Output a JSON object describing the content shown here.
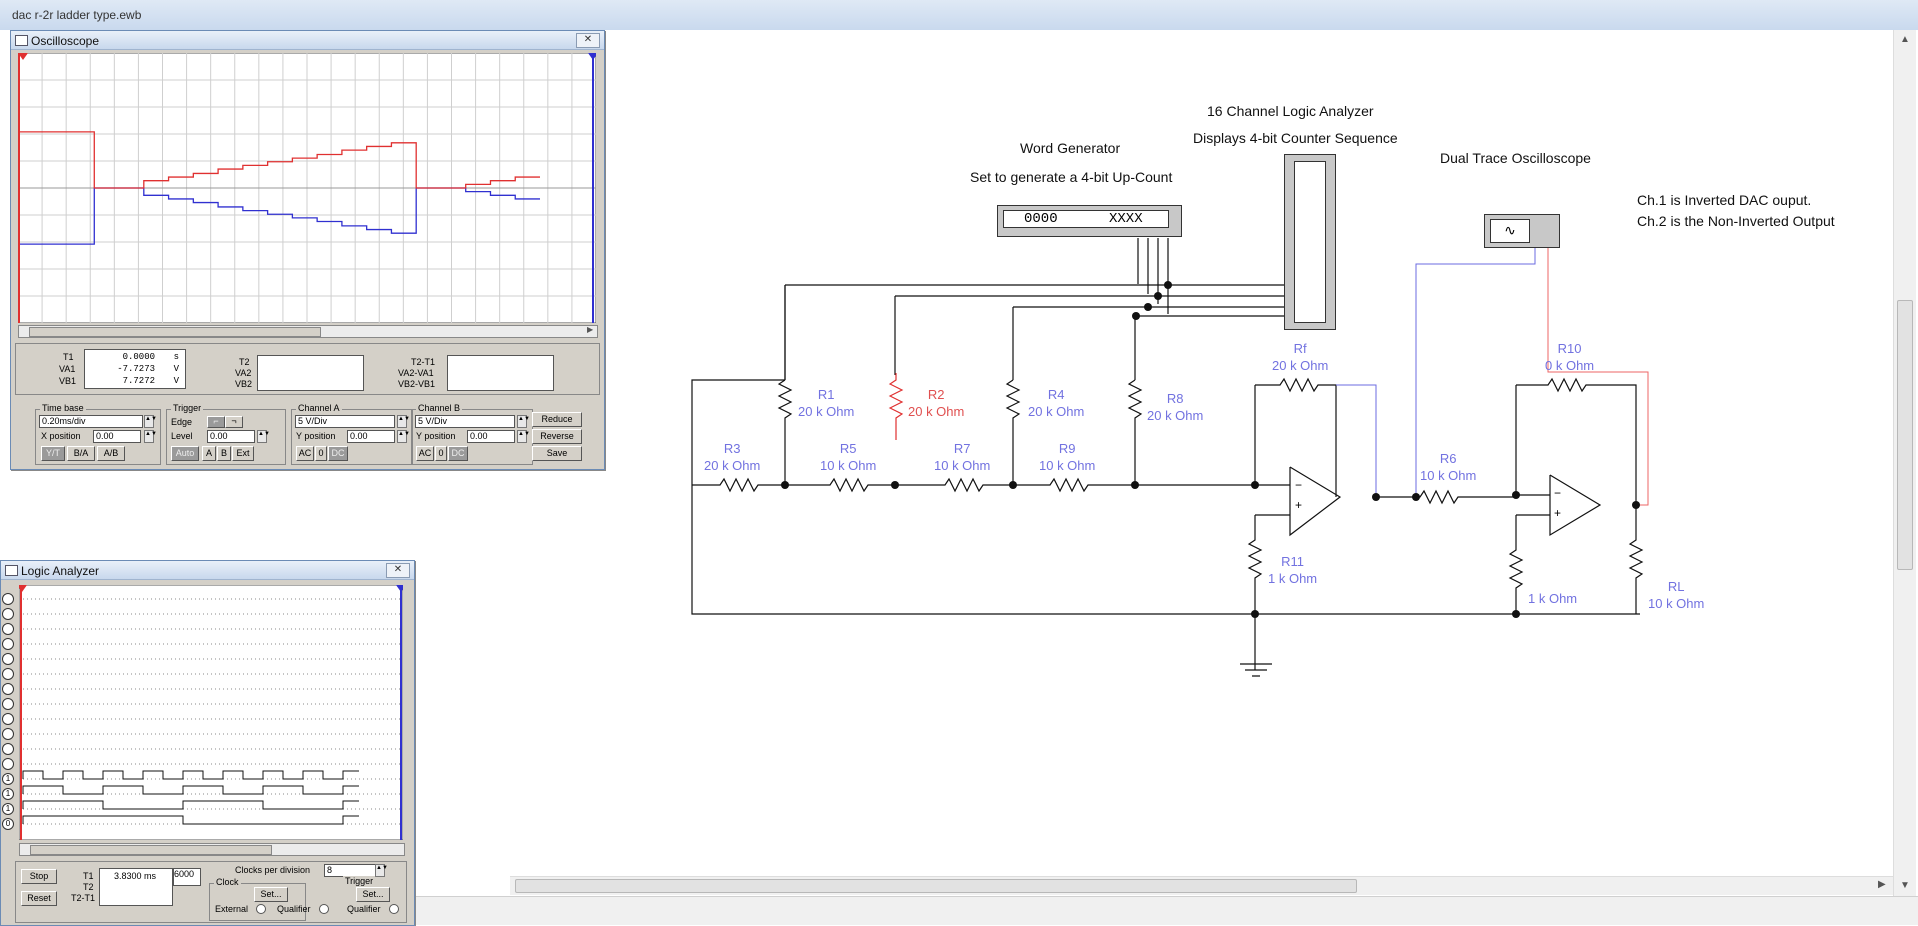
{
  "app": {
    "title": "dac r-2r ladder type.ewb"
  },
  "colors": {
    "channel_a": "#e03030",
    "channel_b": "#3030d0",
    "wire": "#111111",
    "label_blue": "#7272e0",
    "highlight_red": "#e05050"
  },
  "schematic": {
    "notes": {
      "word_generator_title": "Word Generator",
      "word_generator_desc": "Set to generate a 4-bit Up-Count",
      "logic_analyzer_title": "16 Channel Logic Analyzer",
      "logic_analyzer_desc": "Displays 4-bit Counter Sequence",
      "scope_title": "Dual Trace Oscilloscope",
      "ch1_note": "Ch.1 is Inverted DAC ouput.",
      "ch2_note": "Ch.2 is the Non-Inverted Output"
    },
    "word_generator_display": {
      "left": "0000",
      "right": "XXXX"
    },
    "components": [
      {
        "ref": "R1",
        "value": "20 k Ohm"
      },
      {
        "ref": "R2",
        "value": "20 k Ohm"
      },
      {
        "ref": "R3",
        "value": "20 k Ohm"
      },
      {
        "ref": "R4",
        "value": "20 k Ohm"
      },
      {
        "ref": "R5",
        "value": "10 k Ohm"
      },
      {
        "ref": "R6",
        "value": "10 k Ohm"
      },
      {
        "ref": "R7",
        "value": "10 k Ohm"
      },
      {
        "ref": "R8",
        "value": "20 k Ohm"
      },
      {
        "ref": "R9",
        "value": "10 k Ohm"
      },
      {
        "ref": "R10",
        "value": "0 k Ohm"
      },
      {
        "ref": "R11",
        "value": "1 k Ohm"
      },
      {
        "ref": "",
        "value": "1 k Ohm"
      },
      {
        "ref": "Rf",
        "value": "20 k Ohm"
      },
      {
        "ref": "RL",
        "value": "10 k Ohm"
      }
    ]
  },
  "oscilloscope": {
    "title": "Oscilloscope",
    "readouts": {
      "t1_label": "T1",
      "va1_label": "VA1",
      "vb1_label": "VB1",
      "t2_label": "T2",
      "va2_label": "VA2",
      "vb2_label": "VB2",
      "t2t1_label": "T2-T1",
      "va2va1_label": "VA2-VA1",
      "vb2vb1_label": "VB2-VB1",
      "t1": "0.0000",
      "t1_unit": "s",
      "va1": "-7.7273",
      "va1_unit": "V",
      "vb1": "7.7272",
      "vb1_unit": "V"
    },
    "timebase": {
      "group": "Time base",
      "value": "0.20ms/div",
      "xpos_label": "X position",
      "xpos": "0.00",
      "modes": [
        "Y/T",
        "B/A",
        "A/B"
      ]
    },
    "trigger": {
      "group": "Trigger",
      "edge_label": "Edge",
      "level_label": "Level",
      "level": "0.00",
      "sources": [
        "Auto",
        "A",
        "B",
        "Ext"
      ]
    },
    "channel_a": {
      "group": "Channel A",
      "scale": "5 V/Div",
      "ypos_label": "Y position",
      "ypos": "0.00",
      "coupling": [
        "AC",
        "0",
        "DC"
      ]
    },
    "channel_b": {
      "group": "Channel B",
      "scale": "5 V/Div",
      "ypos_label": "Y position",
      "ypos": "0.00",
      "coupling": [
        "AC",
        "0",
        "DC"
      ]
    },
    "buttons": {
      "reduce": "Reduce",
      "reverse": "Reverse",
      "save": "Save"
    },
    "trace_a_volts": [
      7.7,
      7.7,
      7.7,
      7.7,
      7.7,
      7.7,
      7.7,
      7.7,
      7.7,
      7.7,
      7.7,
      7.7,
      0,
      0,
      0,
      0,
      0,
      0,
      0,
      0,
      1.0,
      1.0,
      1.0,
      1.0,
      1.5,
      1.5,
      1.5,
      1.5,
      2.0,
      2.0,
      2.0,
      2.0,
      2.6,
      2.6,
      2.6,
      2.6,
      3.1,
      3.1,
      3.1,
      3.1,
      3.6,
      3.6,
      3.6,
      3.6,
      4.1,
      4.1,
      4.1,
      4.1,
      4.6,
      4.6,
      4.6,
      4.6,
      5.2,
      5.2,
      5.2,
      5.2,
      5.7,
      5.7,
      5.7,
      5.7,
      6.2,
      6.2,
      6.2,
      6.2,
      0,
      0,
      0,
      0,
      0,
      0,
      0,
      0,
      0.5,
      0.5,
      0.5,
      0.5,
      1.0,
      1.0,
      1.0,
      1.0,
      1.5,
      1.5,
      1.5,
      1.5
    ],
    "trace_b_volts": [
      -7.7,
      -7.7,
      -7.7,
      -7.7,
      -7.7,
      -7.7,
      -7.7,
      -7.7,
      -7.7,
      -7.7,
      -7.7,
      -7.7,
      0,
      0,
      0,
      0,
      0,
      0,
      0,
      0,
      -1.0,
      -1.0,
      -1.0,
      -1.0,
      -1.5,
      -1.5,
      -1.5,
      -1.5,
      -2.0,
      -2.0,
      -2.0,
      -2.0,
      -2.6,
      -2.6,
      -2.6,
      -2.6,
      -3.1,
      -3.1,
      -3.1,
      -3.1,
      -3.6,
      -3.6,
      -3.6,
      -3.6,
      -4.1,
      -4.1,
      -4.1,
      -4.1,
      -4.6,
      -4.6,
      -4.6,
      -4.6,
      -5.2,
      -5.2,
      -5.2,
      -5.2,
      -5.7,
      -5.7,
      -5.7,
      -5.7,
      -6.2,
      -6.2,
      -6.2,
      -6.2,
      0,
      0,
      0,
      0,
      0,
      0,
      0,
      0,
      -0.5,
      -0.5,
      -0.5,
      -0.5,
      -1.0,
      -1.0,
      -1.0,
      -1.0,
      -1.5,
      -1.5,
      -1.5,
      -1.5
    ]
  },
  "logic_analyzer": {
    "title": "Logic Analyzer",
    "channel_marks": [
      "",
      "",
      "",
      "",
      "",
      "",
      "",
      "",
      "",
      "",
      "",
      "",
      "1",
      "1",
      "1",
      "0"
    ],
    "buttons": {
      "stop": "Stop",
      "reset": "Reset"
    },
    "readouts": {
      "t1_label": "T1",
      "t2_label": "T2",
      "t2t1_label": "T2-T1",
      "t1": "3.8300 ms",
      "count": "6000"
    },
    "clocks_per_div_label": "Clocks per division",
    "clocks_per_div": "8",
    "clock_group": "Clock",
    "trigger_group": "Trigger",
    "set_label": "Set...",
    "external_label": "External",
    "qualifier_label": "Qualifier"
  }
}
